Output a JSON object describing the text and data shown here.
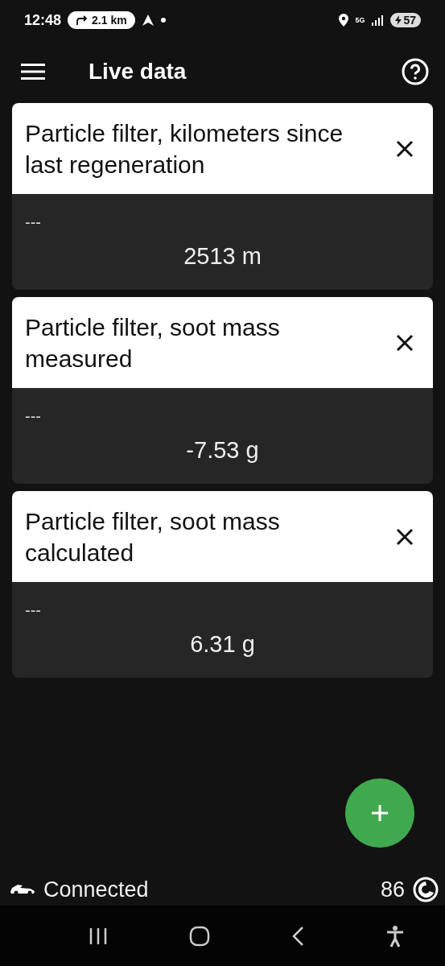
{
  "status_bar": {
    "time": "12:48",
    "navigation_chip": "2.1 km",
    "network": "5G",
    "battery": "57"
  },
  "app_bar": {
    "title": "Live data"
  },
  "cards": [
    {
      "title": "Particle filter, kilometers since last regeneration",
      "label": "---",
      "value": "2513 m"
    },
    {
      "title": "Particle filter, soot mass measured",
      "label": "---",
      "value": "-7.53 g"
    },
    {
      "title": "Particle filter, soot mass calculated",
      "label": "---",
      "value": "6.31 g"
    }
  ],
  "footer": {
    "connection": "Connected",
    "count": "86"
  }
}
